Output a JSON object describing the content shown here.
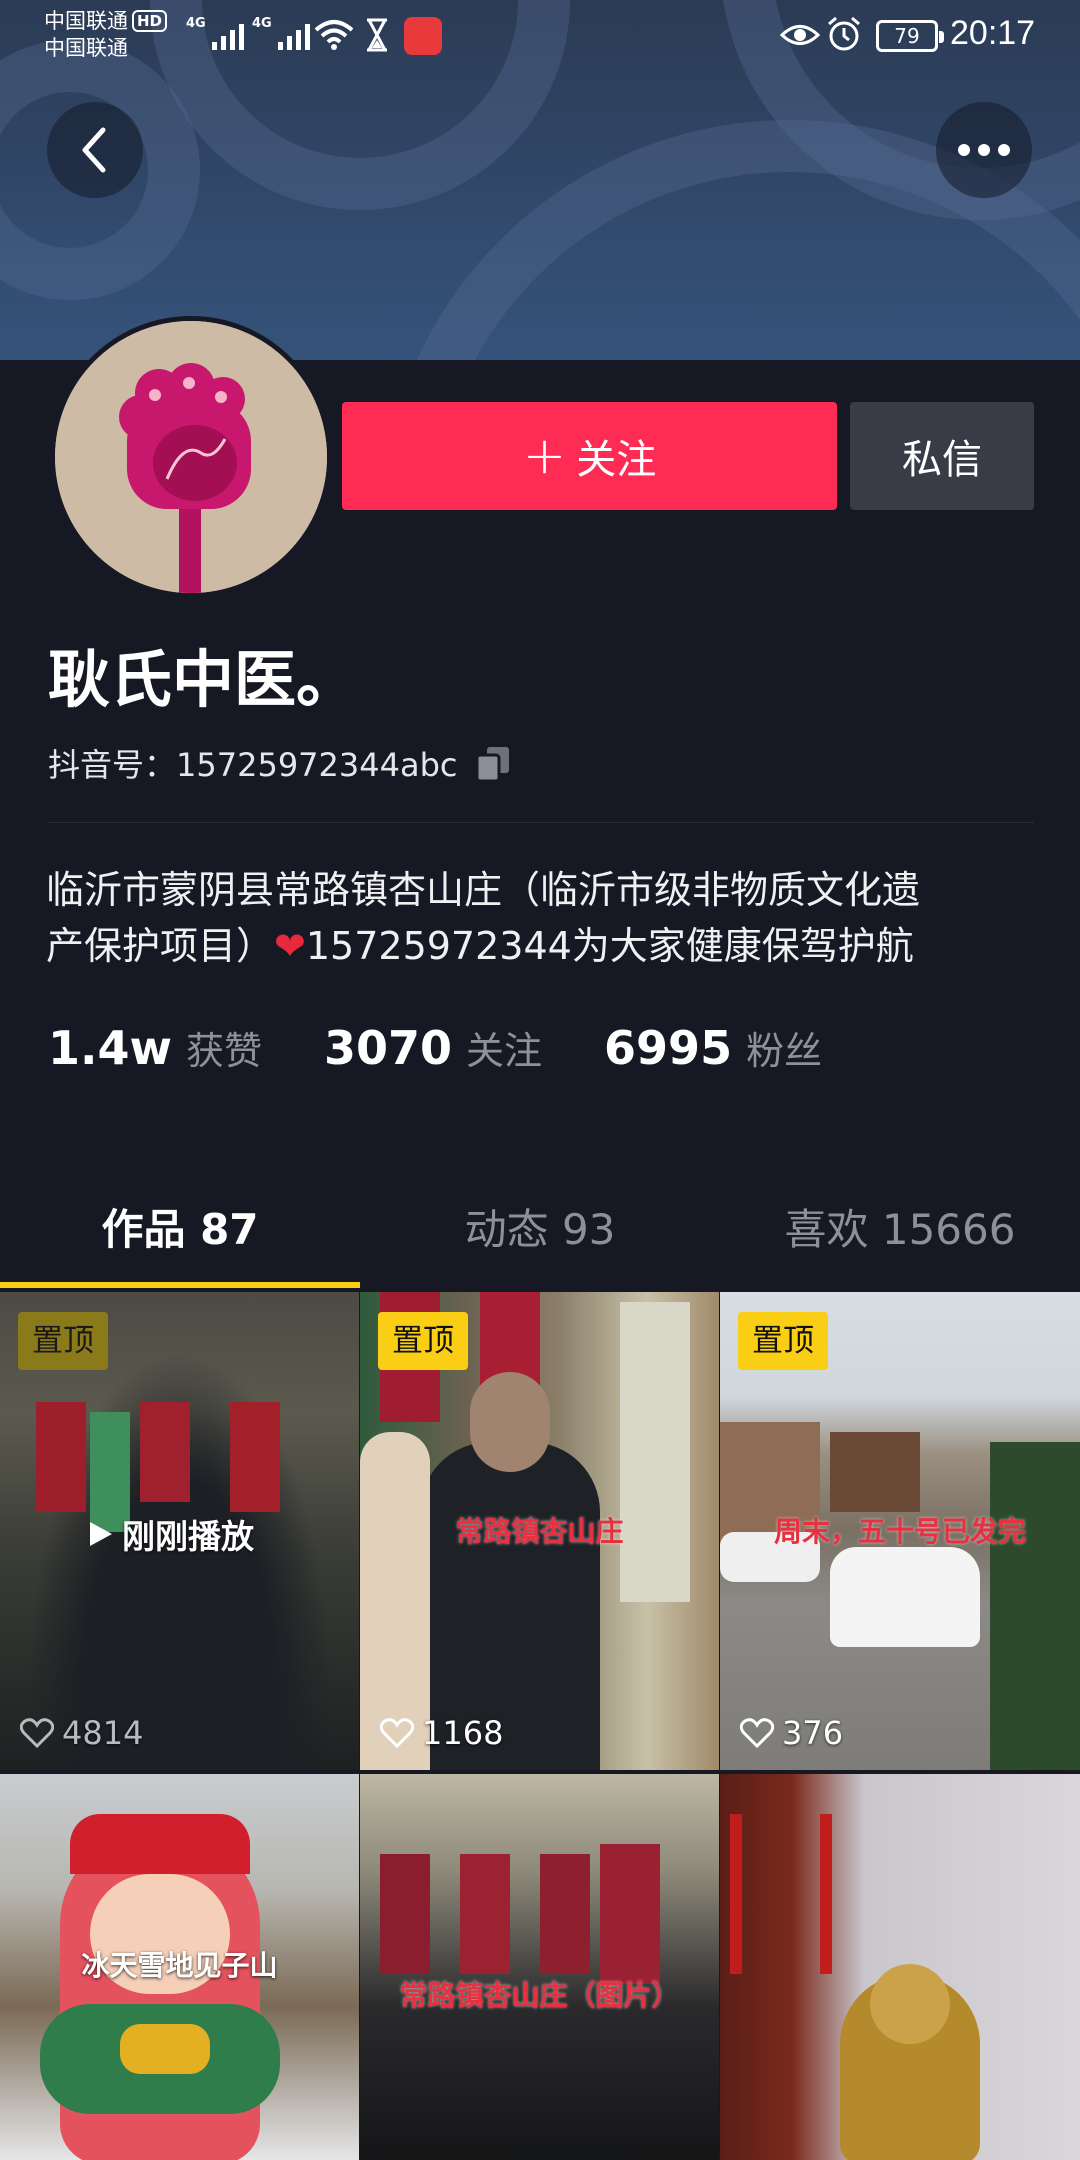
{
  "status_bar": {
    "carrier_1": "中国联通",
    "hd_badge": "HD",
    "carrier_2": "中国联通",
    "network_1": "4G",
    "network_2": "4G",
    "battery": "79",
    "time": "20:17"
  },
  "header": {
    "back_icon": "chevron-left-icon",
    "more_icon": "more-dots-icon"
  },
  "profile": {
    "follow_label": "关注",
    "message_label": "私信",
    "username": "耿氏中医。",
    "douyin_id_prefix": "抖音号：",
    "douyin_id": "15725972344abc",
    "bio_line_1": "临沂市蒙阴县常路镇杏山庄（临沂市级非物质文化遗",
    "bio_line_2_a": "产保护项目）",
    "bio_line_2_b": "15725972344为大家健康保驾护航",
    "stats": [
      {
        "value": "1.4w",
        "label": "获赞"
      },
      {
        "value": "3070",
        "label": "关注"
      },
      {
        "value": "6995",
        "label": "粉丝"
      }
    ]
  },
  "tabs": [
    {
      "label": "作品 87",
      "active": true
    },
    {
      "label": "动态 93",
      "active": false
    },
    {
      "label": "喜欢 15666",
      "active": false
    }
  ],
  "videos": [
    {
      "pinned": "置顶",
      "overlay": "刚刚播放",
      "caption": "",
      "likes": "4814"
    },
    {
      "pinned": "置顶",
      "overlay": "",
      "caption": "常路镇杏山庄",
      "likes": "1168"
    },
    {
      "pinned": "置顶",
      "overlay": "",
      "caption": "周末，五十号已发完",
      "likes": "376"
    },
    {
      "pinned": "",
      "overlay": "",
      "caption": "冰天雪地见子山",
      "likes": ""
    },
    {
      "pinned": "",
      "overlay": "",
      "caption": "常路镇杏山庄（图片）",
      "likes": ""
    },
    {
      "pinned": "",
      "overlay": "",
      "caption": "",
      "likes": ""
    }
  ],
  "colors": {
    "accent_follow": "#fe2c55",
    "tab_indicator": "#face15",
    "background": "#161824"
  }
}
